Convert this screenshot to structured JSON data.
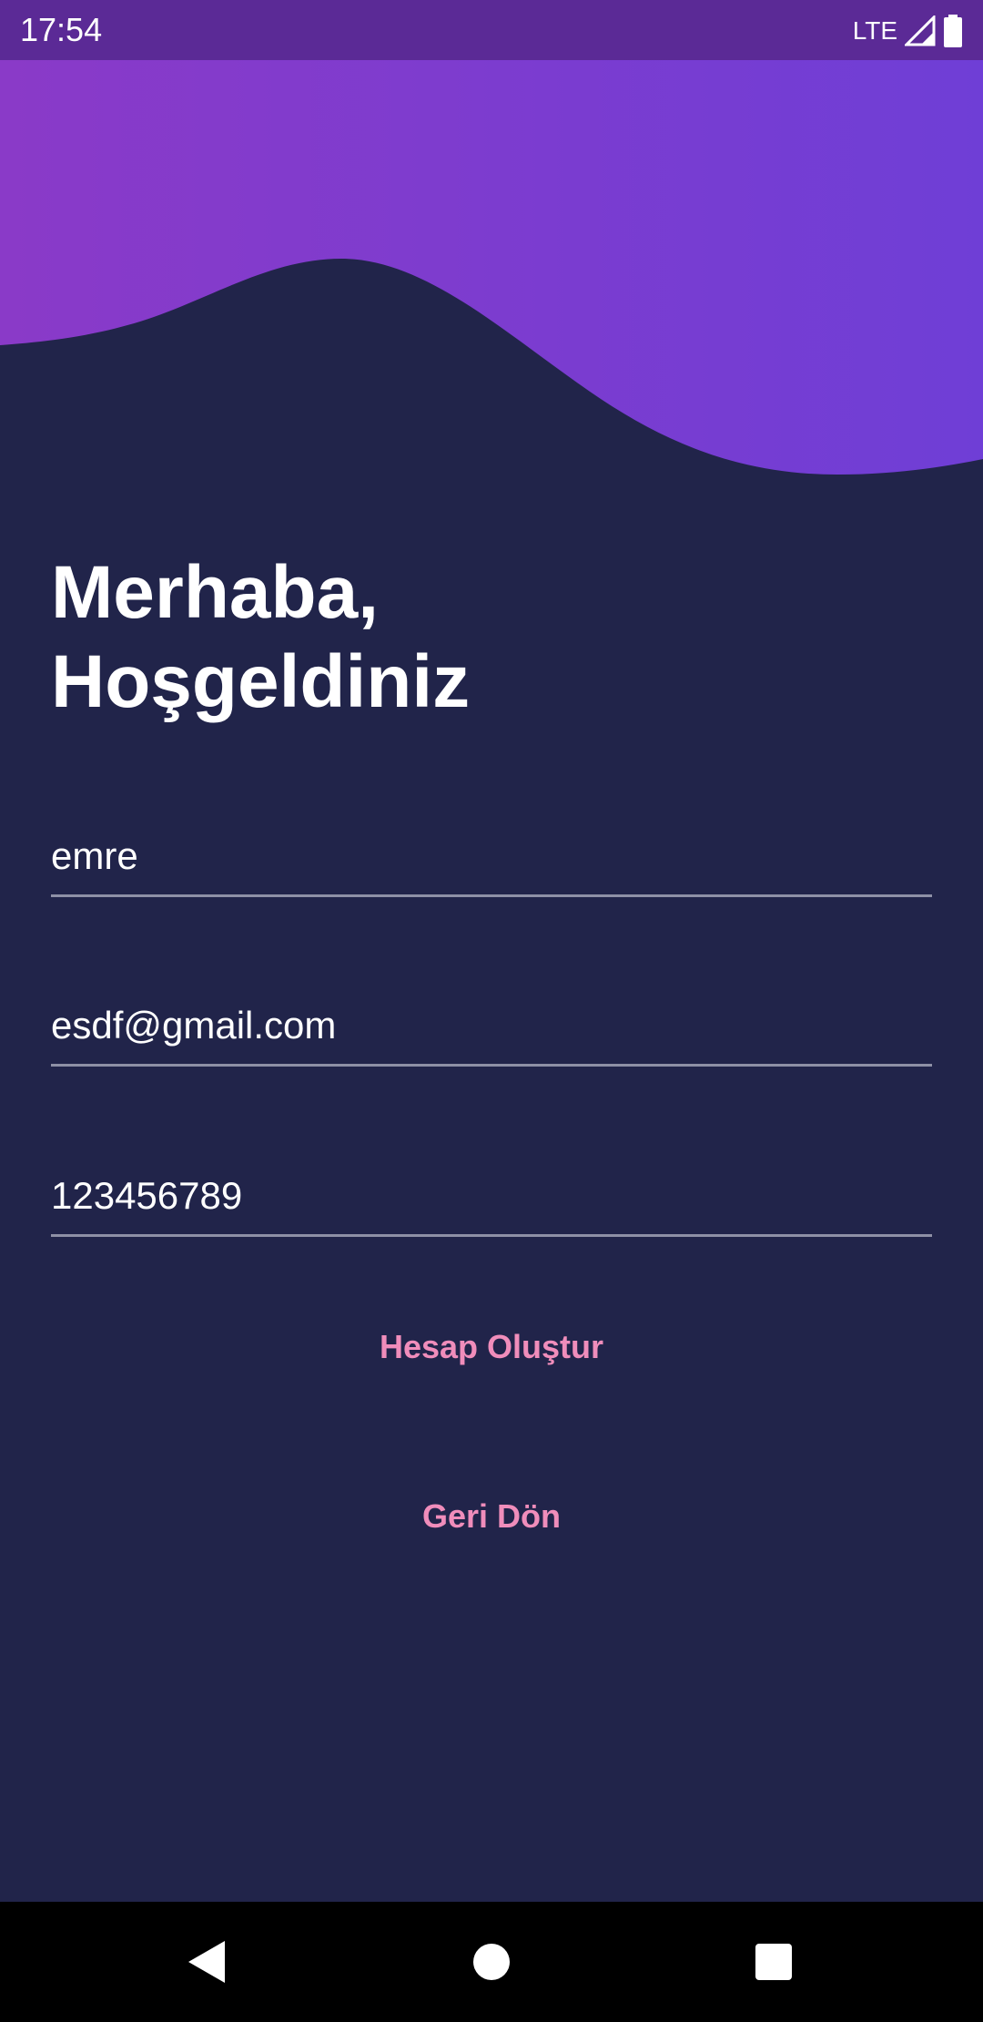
{
  "status_bar": {
    "time": "17:54",
    "network": "LTE",
    "icons": [
      "signal-icon",
      "battery-icon"
    ]
  },
  "colors": {
    "background": "#21244a",
    "status_bar": "#5b2a96",
    "wave_start": "#8a3ac8",
    "wave_end": "#6f3ed6",
    "accent_text": "#f08dbb",
    "underline": "#8e90a6"
  },
  "greeting": {
    "line1": "Merhaba,",
    "line2": "Hoşgeldiniz"
  },
  "form": {
    "name_value": "emre",
    "email_value": "esdf@gmail.com",
    "password_value": "123456789"
  },
  "actions": {
    "create_account_label": "Hesap Oluştur",
    "back_label": "Geri Dön"
  },
  "nav_bar": {
    "icons": [
      "back-triangle-icon",
      "home-circle-icon",
      "recents-square-icon"
    ]
  }
}
